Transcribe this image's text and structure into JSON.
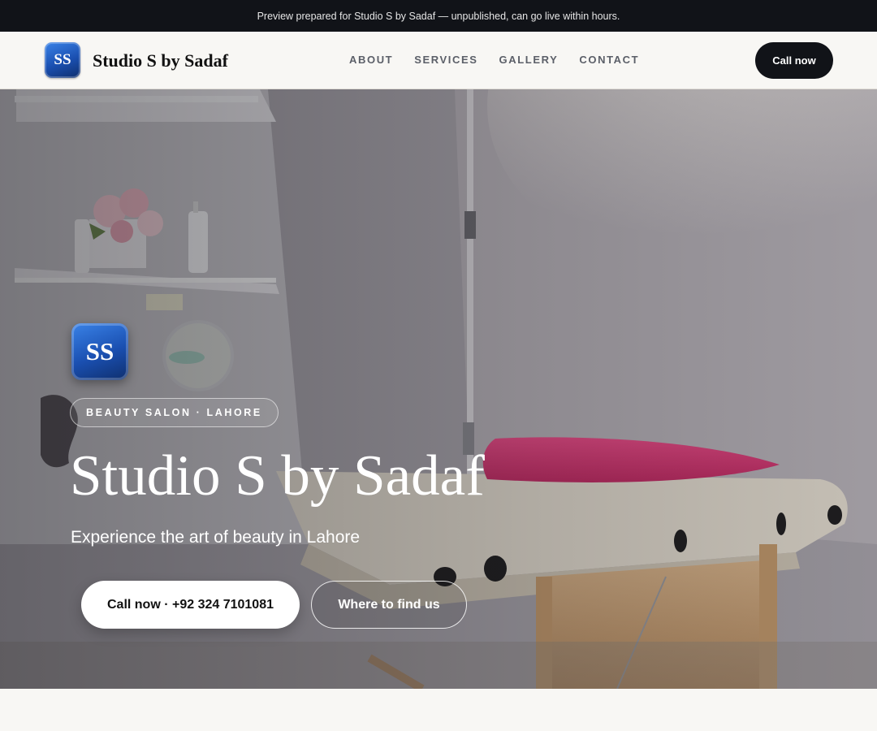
{
  "announcement": {
    "text": "Preview prepared for Studio S by Sadaf — unpublished, can go live within hours."
  },
  "header": {
    "logo_text": "SS",
    "brand_name": "Studio S by Sadaf",
    "nav": [
      {
        "label": "ABOUT"
      },
      {
        "label": "SERVICES"
      },
      {
        "label": "GALLERY"
      },
      {
        "label": "CONTACT"
      }
    ],
    "cta_label": "Call now"
  },
  "hero": {
    "logo_text": "SS",
    "badge": "BEAUTY SALON · LAHORE",
    "title": "Studio S by Sadaf",
    "subtitle": "Experience the art of beauty in Lahore",
    "primary_button": "Call now · +92 324 7101081",
    "secondary_button": "Where to find us",
    "image_alt_icon": "salon-interior-photo"
  },
  "colors": {
    "dark": "#111318",
    "accent_blue": "#1a4fb0",
    "page_bg": "#f8f7f4"
  }
}
